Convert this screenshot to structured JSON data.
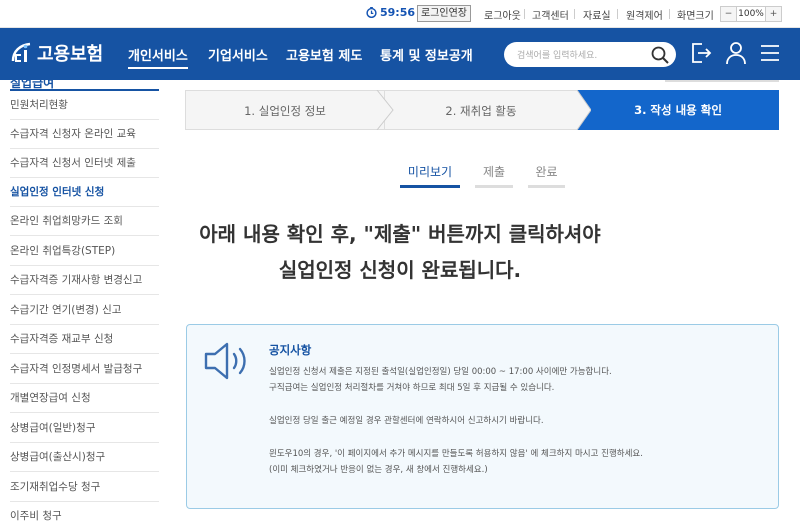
{
  "topbar": {
    "timer": "59:56",
    "relogin": "로그인연장",
    "links": [
      "로그아웃",
      "고객센터",
      "자료실",
      "원격제어",
      "화면크기"
    ],
    "zoom_minus": "−",
    "zoom_value": "100%",
    "zoom_plus": "+"
  },
  "nav": {
    "logo_text": "고용보험",
    "menus": [
      "개인서비스",
      "기업서비스",
      "고용보험 제도",
      "통계 및 정보공개"
    ],
    "search_placeholder": "검색어를 입력하세요."
  },
  "sidebar": {
    "cut_title": "실업급여",
    "items": [
      "민원처리현황",
      "수급자격 신청자 온라인 교육",
      "수급자격 신청서 인터넷 제출",
      "실업인정 인터넷 신청",
      "온라인 취업희망카드 조회",
      "온라인 취업특강(STEP)",
      "수급자격증 기재사항 변경신고",
      "수급기간 연기(변경) 신고",
      "수급자격증 재교부 신청",
      "수급자격 인정명세서 발급청구",
      "개별연장급여 신청",
      "상병급여(일반)청구",
      "상병급여(출산시)청구",
      "조기재취업수당 청구",
      "이주비 청구"
    ],
    "active_index": 3
  },
  "steps": [
    "1. 실업인정 정보",
    "2. 재취업 활동",
    "3. 작성 내용 확인"
  ],
  "tabs": [
    "미리보기",
    "제출",
    "완료"
  ],
  "main_notice": {
    "line1": "아래 내용 확인 후, \"제출\" 버튼까지 클릭하셔야",
    "line2": "실업인정 신청이 완료됩니다."
  },
  "notice_box": {
    "title": "공지사항",
    "lines": [
      "실업인정 신청서 제출은 지정된 출석일(실업인정일) 당일 00:00 ~ 17:00 사이에만 가능합니다.",
      "구직급여는 실업인정 처리절차를 거쳐야 하므로 최대 5일 후 지급될 수 있습니다.",
      "실업인정 당일 출근 예정일 경우 관할센터에 연락하시어 신고하시기 바랍니다.",
      "윈도우10의 경우, '이 페이지에서 추가 메시지를 만들도록 허용하지 않음' 에 체크하지 마시고 진행하세요.",
      "(이미 체크하였거나 반응이 없는 경우, 새 창에서 진행하세요.)"
    ]
  },
  "colors": {
    "brand": "#1653a3",
    "step_active": "#1366cb",
    "box_border": "#9bcbe6"
  }
}
